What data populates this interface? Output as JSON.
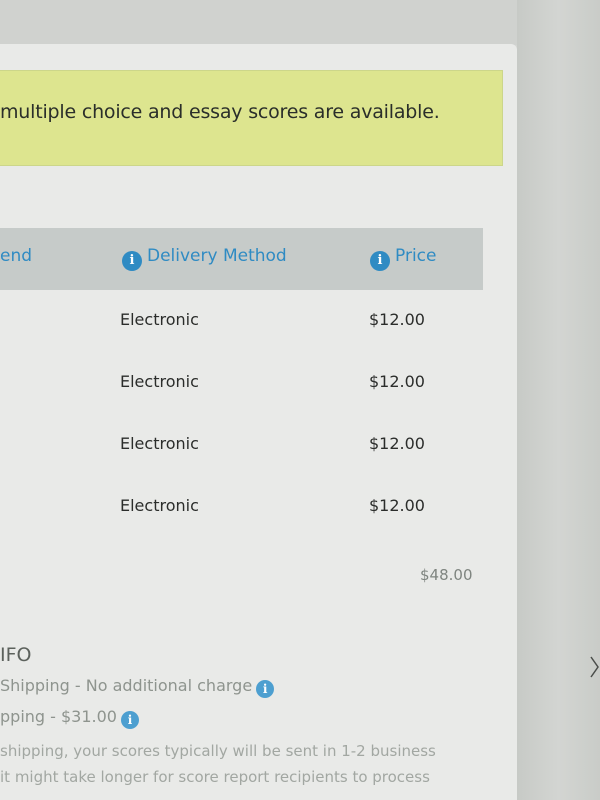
{
  "notice": {
    "text": "multiple choice and essay scores are available."
  },
  "table": {
    "columns": [
      {
        "label": "end",
        "has_info_icon": false
      },
      {
        "label": "Delivery Method",
        "has_info_icon": true
      },
      {
        "label": "Price",
        "has_info_icon": true
      }
    ],
    "rows": [
      {
        "delivery": "Electronic",
        "price": "$12.00"
      },
      {
        "delivery": "Electronic",
        "price": "$12.00"
      },
      {
        "delivery": "Electronic",
        "price": "$12.00"
      },
      {
        "delivery": "Electronic",
        "price": "$12.00"
      }
    ],
    "total": "$48.00"
  },
  "shipping": {
    "title": "IFO",
    "options": [
      {
        "text": "Shipping - No additional charge",
        "has_info_icon": true
      },
      {
        "text": "pping - $31.00",
        "has_info_icon": true
      }
    ],
    "note_lines": [
      "shipping, your scores typically will be sent in 1-2 business",
      "it might take longer for score report recipients to process"
    ]
  },
  "colors": {
    "notice_bg": "#dde58f",
    "header_bg": "#c6cbc9",
    "accent_blue": "#2f8bc3",
    "panel_bg": "#e9eae8"
  },
  "icons": {
    "info": "info-icon",
    "cursor": "resize-cursor-icon"
  }
}
